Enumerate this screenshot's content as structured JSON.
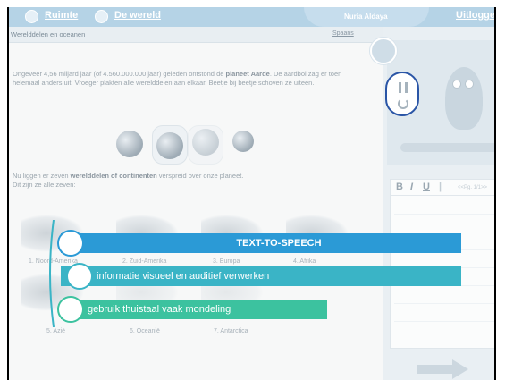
{
  "topbar": {
    "nav_space": "Ruimte",
    "nav_world": "De wereld",
    "user_name": "Nuria Aldaya",
    "logout": "Uitloggen"
  },
  "content": {
    "title": "Werelddelen en oceanen",
    "language_link": "Spaans",
    "paragraph1_a": "Ongeveer 4,56 miljard jaar (of 4.560.000.000 jaar) geleden ontstond de ",
    "paragraph1_b": "planeet Aarde",
    "paragraph1_c": ". De aardbol zag er toen helemaal anders uit. Vroeger plakten alle werelddelen aan elkaar. Beetje bij beetje schoven ze uiteen.",
    "paragraph2_a": "Nu liggen er zeven ",
    "paragraph2_b": "werelddelen of continenten",
    "paragraph2_c": " verspreid over onze planeet.",
    "paragraph2_d": "Dit zijn ze alle zeven:",
    "continents": [
      "1. Noord-Amerika",
      "2. Zuid-Amerika",
      "3. Europa",
      "4. Afrika",
      "5. Azië",
      "6. Oceanië",
      "7. Antarctica"
    ]
  },
  "notepad": {
    "bold": "B",
    "italic": "I",
    "underline": "U",
    "pager": "<<Pg. 1/1>>"
  },
  "overlay": {
    "banner1": "TEXT-TO-SPEECH",
    "banner2": "informatie visueel en auditief verwerken",
    "banner3": "gebruik thuistaal vaak mondeling"
  },
  "colors": {
    "banner1": "#2b9ad6",
    "banner2": "#3ab4c6",
    "banner3": "#3cc29f",
    "controls_border": "#2a55a6",
    "topbar": "#b5d3e6"
  }
}
